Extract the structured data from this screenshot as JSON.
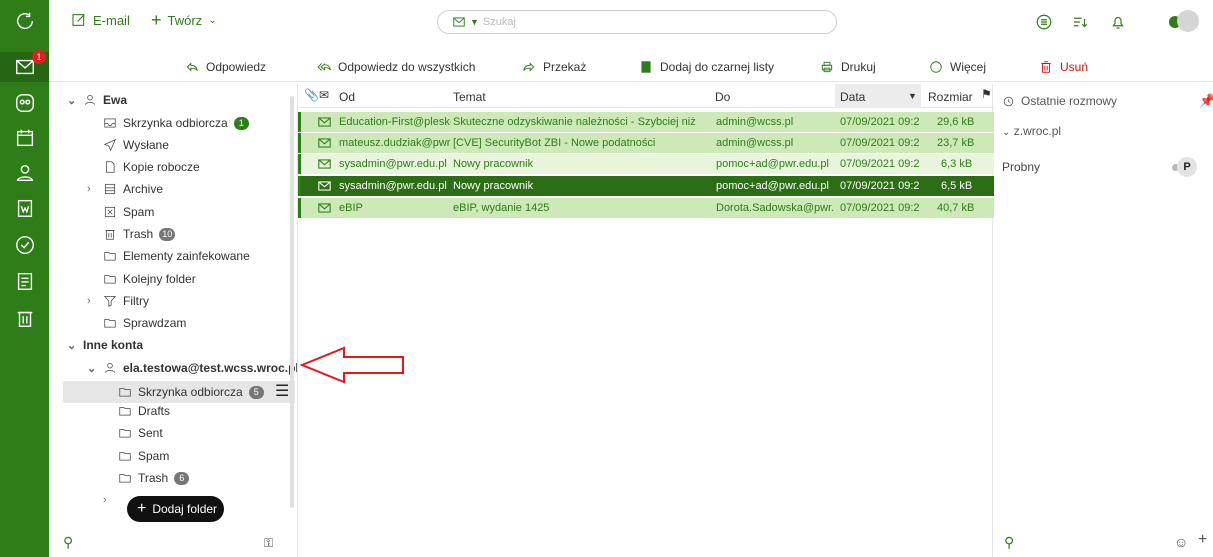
{
  "topbar": {
    "email_label": "E-mail",
    "create_label": "Twórz",
    "search_placeholder": "Szukaj"
  },
  "rail": {
    "mail_badge": "1"
  },
  "actions": {
    "reply": "Odpowiedz",
    "reply_all": "Odpowiedz do wszystkich",
    "forward": "Przekaż",
    "blacklist": "Dodaj do czarnej listy",
    "print": "Drukuj",
    "more": "Więcej",
    "delete": "Usuń"
  },
  "tree": {
    "account1": "Ewa",
    "inbox": "Skrzynka odbiorcza",
    "inbox_count": "1",
    "sent": "Wysłane",
    "drafts": "Kopie robocze",
    "archive": "Archive",
    "spam": "Spam",
    "trash": "Trash",
    "trash_count": "10",
    "infected": "Elementy zainfekowane",
    "next_folder": "Kolejny folder",
    "filters": "Filtry",
    "checking": "Sprawdzam",
    "other_accounts": "Inne konta",
    "account2": "ela.testowa@test.wcss.wroc.pl",
    "a2_inbox": "Skrzynka odbiorcza",
    "a2_inbox_count": "5",
    "a2_drafts": "Drafts",
    "a2_sent": "Sent",
    "a2_spam": "Spam",
    "a2_trash": "Trash",
    "a2_trash_count": "6",
    "add_folder": "Dodaj folder"
  },
  "list": {
    "headers": {
      "from": "Od",
      "subject": "Temat",
      "to": "Do",
      "date": "Data",
      "size": "Rozmiar"
    },
    "rows": [
      {
        "from": "Education-First@plesk-1",
        "subject": "Skuteczne odzyskiwanie należności - Szybciej niż",
        "to": "admin@wcss.pl",
        "date": "07/09/2021 09:2",
        "size": "29,6 kB"
      },
      {
        "from": "mateusz.dudziak@pwr.e",
        "subject": "[CVE] SecurityBot ZBI - Nowe podatności",
        "to": "admin@wcss.pl",
        "date": "07/09/2021 09:2",
        "size": "23,7 kB"
      },
      {
        "from": "sysadmin@pwr.edu.pl",
        "subject": "Nowy pracownik",
        "to": "pomoc+ad@pwr.edu.pl",
        "date": "07/09/2021 09:2",
        "size": "6,3 kB"
      },
      {
        "from": "sysadmin@pwr.edu.pl",
        "subject": "Nowy pracownik",
        "to": "pomoc+ad@pwr.edu.pl",
        "date": "07/09/2021 09:2",
        "size": "6,5 kB"
      },
      {
        "from": "eBIP",
        "subject": "eBIP, wydanie 1425",
        "to": "Dorota.Sadowska@pwr.",
        "date": "07/09/2021 09:2",
        "size": "40,7 kB"
      }
    ]
  },
  "right": {
    "title": "Ostatnie rozmowy",
    "group": "z.wroc.pl",
    "contact": "Probny",
    "avatar_letter": "P"
  }
}
